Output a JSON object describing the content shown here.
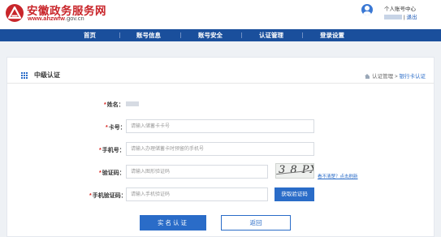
{
  "header": {
    "site_title": "安徽政务服务网",
    "site_url_bold": "www.ahzwfw",
    "site_url_rest": ".gov.cn",
    "user_center": "个人账号中心",
    "logout": "退出",
    "logo_icon": "province-logo-icon",
    "avatar_icon": "user-avatar-icon"
  },
  "nav": {
    "items": [
      "首页",
      "账号信息",
      "账号安全",
      "认证管理",
      "登录设置"
    ]
  },
  "panel": {
    "title": "中级认证",
    "breadcrumb": {
      "parent": "认证管理",
      "separator": ">",
      "current": "银行卡认证"
    }
  },
  "form": {
    "name_label": "姓名：",
    "card_label": "卡号：",
    "card_placeholder": "请输入储蓄卡卡号",
    "phone_label": "手机号：",
    "phone_placeholder": "请输入办理储蓄卡时预留的手机号",
    "captcha_label": "验证码：",
    "captcha_placeholder": "请输入图形验证码",
    "captcha_text": "3 8 PX",
    "refresh_text": "看不清楚？点击刷新",
    "sms_label": "手机验证码：",
    "sms_placeholder": "请输入手机验证码",
    "sms_button": "获取验证码",
    "required_mark": "*"
  },
  "actions": {
    "submit": "实名认证",
    "back": "返回"
  },
  "colors": {
    "brand_red": "#c9262b",
    "nav_blue": "#1a4f9c",
    "accent_blue": "#2a6cc8"
  }
}
